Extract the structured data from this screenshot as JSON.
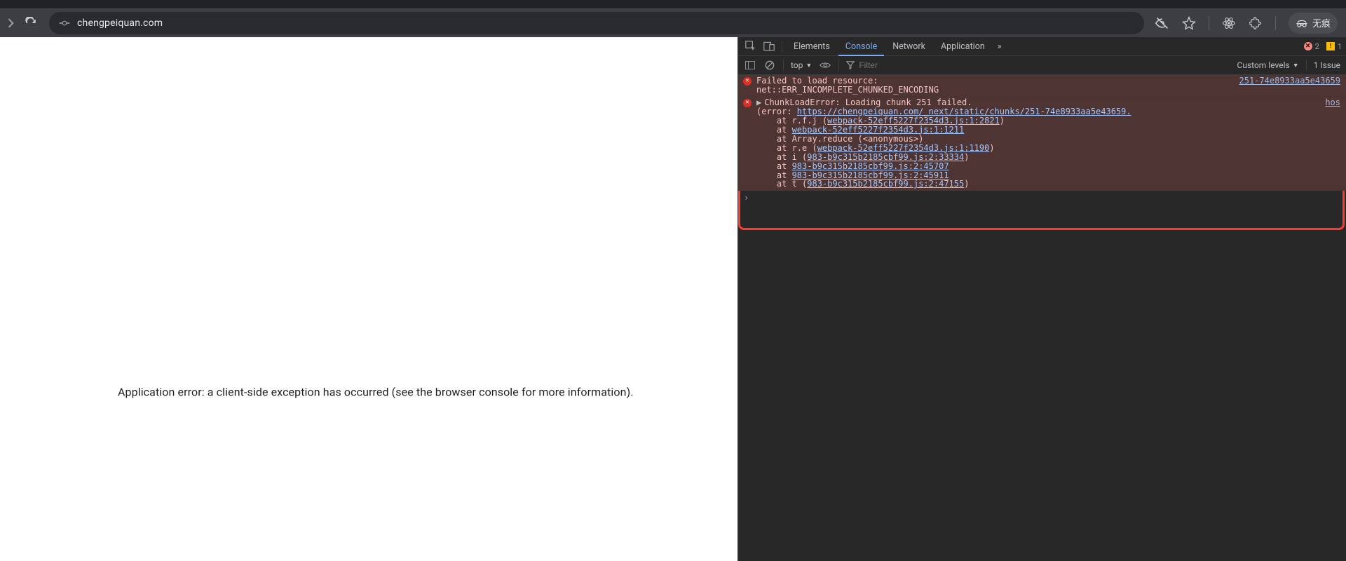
{
  "browser": {
    "url": "chengpeiquan.com",
    "incognito_label": "无痕"
  },
  "page": {
    "error_message": "Application error: a client-side exception has occurred (see the browser console for more information)."
  },
  "devtools": {
    "tabs": {
      "elements": "Elements",
      "console": "Console",
      "network": "Network",
      "application": "Application"
    },
    "error_count": "2",
    "warning_count": "1",
    "toolbar": {
      "context": "top",
      "filter_placeholder": "Filter",
      "levels": "Custom levels",
      "issues": "1 Issue"
    },
    "messages": [
      {
        "line1": "Failed to load resource:",
        "line2": "net::ERR_INCOMPLETE_CHUNKED_ENCODING",
        "source": "251-74e8933aa5e43659"
      },
      {
        "head": "ChunkLoadError: Loading chunk 251 failed.",
        "err_open": "(error: ",
        "err_url": "https://chengpeiquan.com/_next/static/chunks/251-74e8933aa5e43659.",
        "source": "hos",
        "stack": [
          {
            "pre": "    at r.f.j (",
            "link": "webpack-52eff5227f2354d3.js:1:2821",
            "post": ")"
          },
          {
            "pre": "    at ",
            "link": "webpack-52eff5227f2354d3.js:1:1211",
            "post": ""
          },
          {
            "pre": "    at Array.reduce (<anonymous>)",
            "link": "",
            "post": ""
          },
          {
            "pre": "    at r.e (",
            "link": "webpack-52eff5227f2354d3.js:1:1190",
            "post": ")"
          },
          {
            "pre": "    at i (",
            "link": "983-b9c315b2185cbf99.js:2:33334",
            "post": ")"
          },
          {
            "pre": "    at ",
            "link": "983-b9c315b2185cbf99.js:2:45707",
            "post": ""
          },
          {
            "pre": "    at ",
            "link": "983-b9c315b2185cbf99.js:2:45911",
            "post": ""
          },
          {
            "pre": "    at t (",
            "link": "983-b9c315b2185cbf99.js:2:47155",
            "post": ")"
          }
        ]
      }
    ]
  }
}
